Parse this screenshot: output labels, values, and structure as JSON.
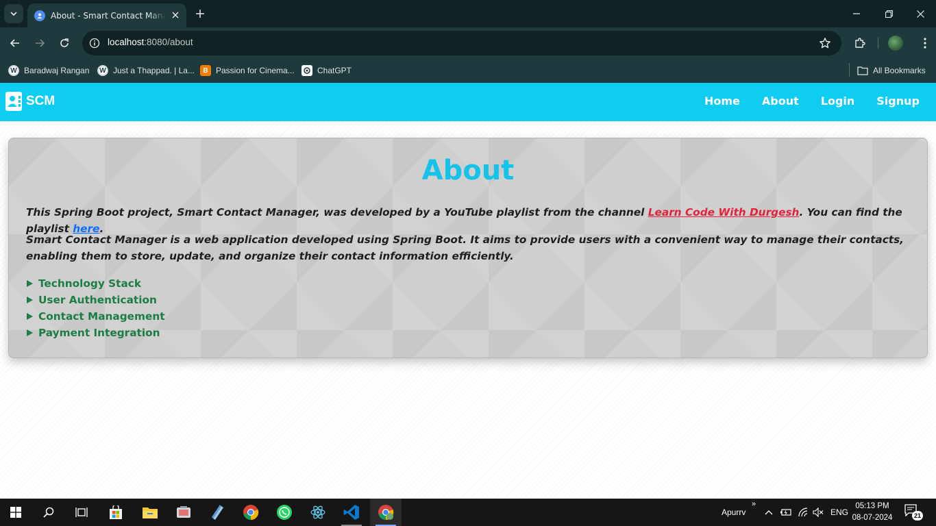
{
  "browser": {
    "tab_title": "About - Smart Contact Manager",
    "url_host": "localhost",
    "url_path": ":8080/about",
    "bookmarks": [
      {
        "label": "Baradwaj Rangan",
        "icon": "wordpress-icon"
      },
      {
        "label": "Just a Thappad. | La...",
        "icon": "wordpress-icon"
      },
      {
        "label": "Passion for Cinema...",
        "icon": "blogger-icon"
      },
      {
        "label": "ChatGPT",
        "icon": "chatgpt-icon"
      }
    ],
    "all_bookmarks_label": "All Bookmarks"
  },
  "navbar": {
    "brand": "SCM",
    "links": [
      "Home",
      "About",
      "Login",
      "Signup"
    ]
  },
  "about": {
    "title": "About",
    "p1_prefix": "This Spring Boot project, Smart Contact Manager, was developed by a YouTube playlist from the channel ",
    "p1_channel_link": "Learn Code With Durgesh",
    "p1_middle": ". You can find the playlist ",
    "p1_here_link": "here",
    "p1_suffix": ".",
    "p2": "Smart Contact Manager is a web application developed using Spring Boot. It aims to provide users with a convenient way to manage their contacts, enabling them to store, update, and organize their contact information efficiently.",
    "sections": [
      "Technology Stack",
      "User Authentication",
      "Contact Management",
      "Payment Integration"
    ]
  },
  "taskbar": {
    "user_label": "Apurrv",
    "language": "ENG",
    "time": "05:13 PM",
    "date": "08-07-2024",
    "notification_count": "21"
  },
  "colors": {
    "navbar": "#0ecdf0",
    "title": "#15c3ea",
    "section_green": "#1c7d45",
    "link_red": "#e0243b",
    "link_blue": "#0d6efd"
  }
}
